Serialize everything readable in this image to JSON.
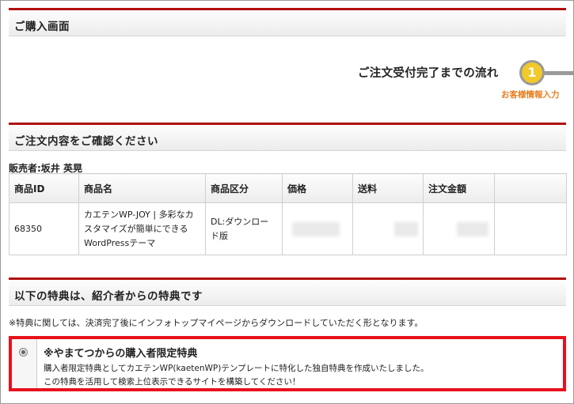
{
  "purchase_header": {
    "title": "ご購入画面"
  },
  "flow": {
    "label": "ご注文受付完了までの流れ",
    "step_number": "1",
    "step_label": "お客様情報入力"
  },
  "confirm_header": {
    "title": "ご注文内容をご確認ください"
  },
  "seller": {
    "text": "販売者:坂井 英晃"
  },
  "order_table": {
    "headers": [
      "商品ID",
      "商品名",
      "商品区分",
      "価格",
      "送料",
      "注文金額",
      ""
    ],
    "row": {
      "id": "68350",
      "name": "カエテンWP-JOY | 多彩なカスタマイズが簡単にできるWordPressテーマ",
      "category": "DL:ダウンロード版"
    }
  },
  "bonus_header": {
    "title": "以下の特典は、紹介者からの特典です"
  },
  "bonus_note": "※特典に関しては、決済完了後にインフォトップマイページからダウンロードしていただく形となります。",
  "bonus": {
    "title": "※やまてつからの購入者限定特典",
    "line1": "購入者限定特典としてカエテンWP(kaetenWP)テンプレートに特化した独自特典を作成いたしました。",
    "line2": "この特典を活用して検索上位表示できるサイトを構築してください！"
  },
  "colors": {
    "accent_red": "#b0100f",
    "highlight_red": "#e8111c",
    "step_yellow": "#f1c92a",
    "step_label_orange": "#e67e1f"
  }
}
